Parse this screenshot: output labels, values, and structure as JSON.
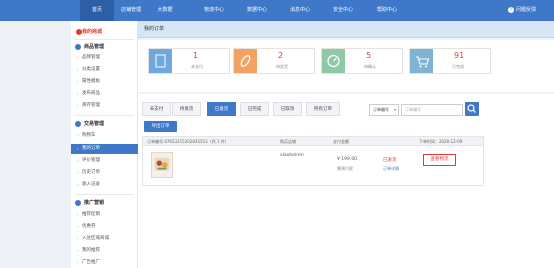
{
  "nav": {
    "items": [
      "首页",
      "店铺管理",
      "大数据",
      "物流中心",
      "数据中心",
      "消息中心",
      "安全中心",
      "帮助中心"
    ],
    "help_label": "问题反馈"
  },
  "sidebar": {
    "shop_label": "我的商城",
    "sections": [
      {
        "title": "商品管理",
        "items": [
          "品牌管理",
          "分类设置",
          "属性模板",
          "发布商品",
          "库存管理"
        ]
      },
      {
        "title": "交易管理",
        "items": [
          "购物车",
          "我的订单",
          "评价管理",
          "历史订单",
          "收入记录"
        ]
      },
      {
        "title": "推广营销",
        "items": [
          "推荐促销",
          "优惠券",
          "入驻区域商城",
          "我的推荐",
          "广告推广"
        ]
      }
    ],
    "active_item": "我的订单"
  },
  "main": {
    "title": "我的订单",
    "stats": [
      {
        "value": "1",
        "label": "未支付",
        "color": "#6fa8dc"
      },
      {
        "value": "2",
        "label": "待发货",
        "color": "#f4a261"
      },
      {
        "value": "5",
        "label": "待确认",
        "color": "#8ec9a5"
      },
      {
        "value": "91",
        "label": "已完成",
        "color": "#7fb3d5"
      }
    ],
    "tabs": [
      "未支付",
      "待发货",
      "已发货",
      "已完成",
      "已取消",
      "所有订单"
    ],
    "active_tab": "已发货",
    "filter": {
      "select_value": "订单编号",
      "input_placeholder": "订单编号"
    },
    "export_label": "导出订单",
    "table_header": {
      "order_no": "订单编号:47653215202835553（共 1 件）",
      "buyer": "购买店铺",
      "payment": "支付金额",
      "time": "下单时间：2020-12-09"
    },
    "order": {
      "buyer": "xiaoheiren",
      "amount": "¥ 199.00",
      "amount_note": "需预付款",
      "status": "已发货",
      "status_link": "订单详情",
      "action": "查看物流"
    }
  },
  "colors": {
    "brand": "#3f78c8",
    "accent": "#e03b3b",
    "title_bg": "#d7e6f7"
  }
}
